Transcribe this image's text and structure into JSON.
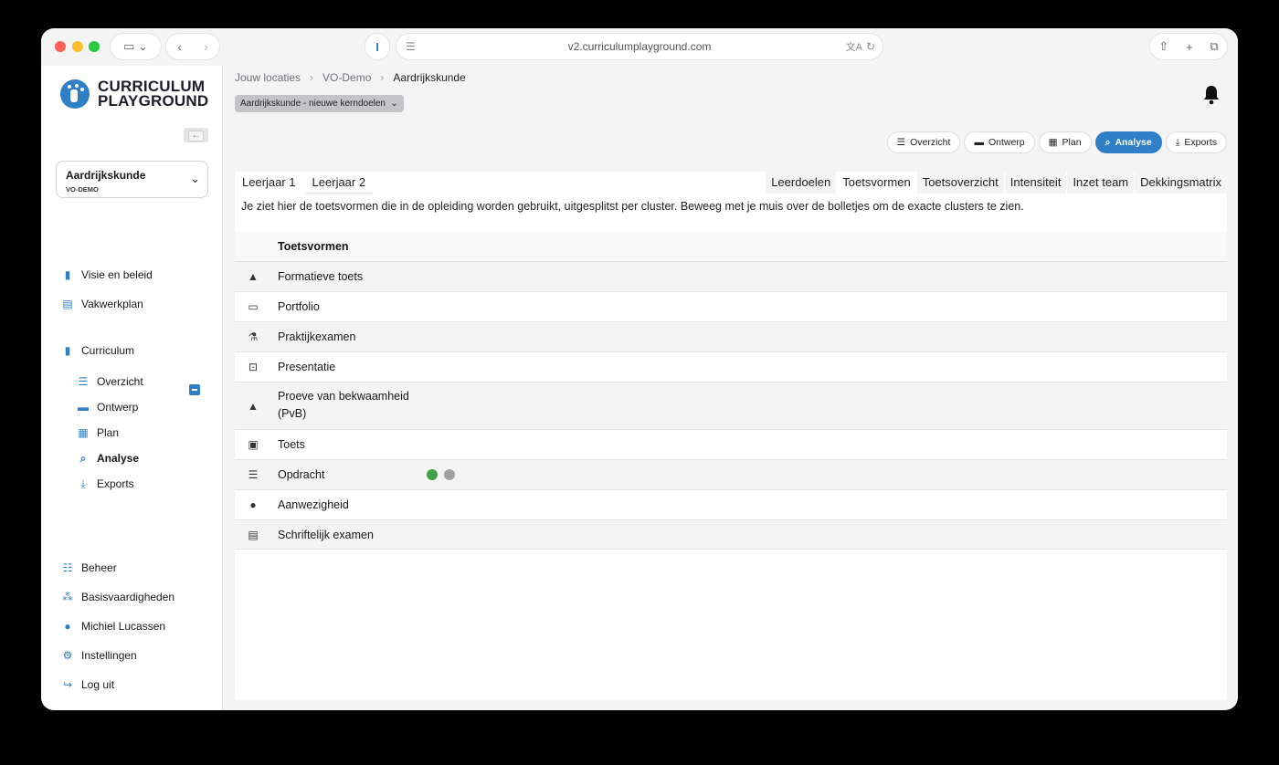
{
  "browser": {
    "url": "v2.curriculumplayground.com"
  },
  "sidebar": {
    "logo_line1": "CURRICULUM",
    "logo_line2": "PLAYGROUND",
    "course": {
      "name": "Aardrijkskunde",
      "sub": "VO-DEMO"
    },
    "nav": [
      {
        "label": "Visie en beleid",
        "icon": "book-icon"
      },
      {
        "label": "Vakwerkplan",
        "icon": "clipboard-icon"
      },
      {
        "label": "Curriculum",
        "icon": "book-icon"
      }
    ],
    "sub_nav": [
      {
        "label": "Overzicht",
        "icon": "list-icon"
      },
      {
        "label": "Ontwerp",
        "icon": "layers-icon"
      },
      {
        "label": "Plan",
        "icon": "calendar-icon"
      },
      {
        "label": "Analyse",
        "icon": "magnifier-icon"
      },
      {
        "label": "Exports",
        "icon": "download-icon"
      }
    ],
    "bottom_nav": [
      {
        "label": "Beheer",
        "icon": "sliders-icon"
      },
      {
        "label": "Basisvaardigheden",
        "icon": "cubes-icon"
      },
      {
        "label": "Michiel Lucassen",
        "icon": "user-icon"
      },
      {
        "label": "Instellingen",
        "icon": "gear-icon"
      },
      {
        "label": "Log uit",
        "icon": "logout-icon"
      }
    ]
  },
  "breadcrumb": [
    "Jouw locaties",
    "VO-Demo",
    "Aardrijkskunde"
  ],
  "variant": "Aardrijkskunde - nieuwe kerndoelen",
  "top_tabs": [
    {
      "label": "Overzicht",
      "active": false
    },
    {
      "label": "Ontwerp",
      "active": false
    },
    {
      "label": "Plan",
      "active": false
    },
    {
      "label": "Analyse",
      "active": true
    },
    {
      "label": "Exports",
      "active": false
    }
  ],
  "year_tabs": [
    "Leerjaar 1",
    "Leerjaar 2"
  ],
  "analysis_tabs": [
    "Leerdoelen",
    "Toetsvormen",
    "Toetsoverzicht",
    "Intensiteit",
    "Inzet team",
    "Dekkingsmatrix"
  ],
  "intro": "Je ziet hier de toetsvormen die in de opleiding worden gebruikt, uitgesplitst per cluster. Beweeg met je muis over de bolletjes om de exacte clusters te zien.",
  "table": {
    "header": "Toetsvormen",
    "rows": [
      {
        "label": "Formatieve toets",
        "icon": "shapes-icon"
      },
      {
        "label": "Portfolio",
        "icon": "open-book-icon"
      },
      {
        "label": "Praktijkexamen",
        "icon": "microscope-icon"
      },
      {
        "label": "Presentatie",
        "icon": "presenter-icon"
      },
      {
        "label": "Proeve van bekwaamheid",
        "label2": "(PvB)",
        "icon": "shapes-icon"
      },
      {
        "label": "Toets",
        "icon": "reader-icon"
      },
      {
        "label": "Opdracht",
        "icon": "checklist-icon",
        "dots": [
          "green",
          "grey"
        ]
      },
      {
        "label": "Aanwezigheid",
        "icon": "user-check-icon"
      },
      {
        "label": "Schriftelijk examen",
        "icon": "document-icon"
      }
    ]
  },
  "colors": {
    "accent": "#2f7fc6",
    "dot_green": "#43a047",
    "dot_grey": "#a0a0a0"
  }
}
